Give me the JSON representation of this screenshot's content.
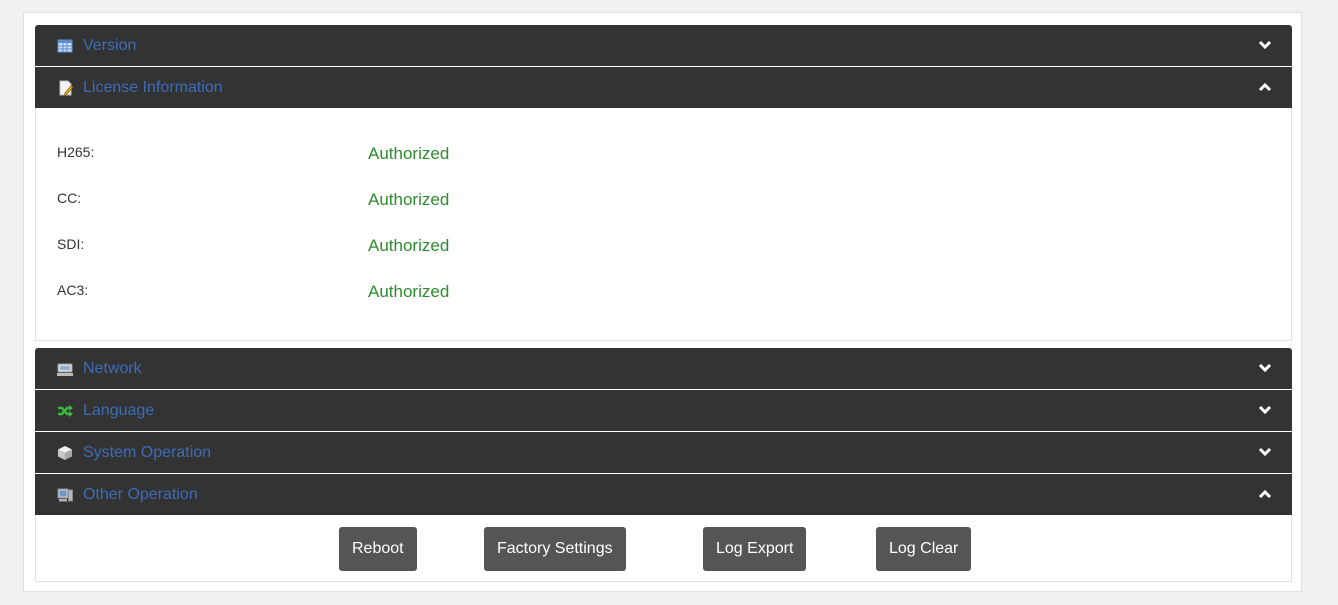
{
  "sections": {
    "version": {
      "title": "Version"
    },
    "license": {
      "title": "License Information"
    },
    "network": {
      "title": "Network"
    },
    "language": {
      "title": "Language"
    },
    "system": {
      "title": "System Operation"
    },
    "other": {
      "title": "Other Operation"
    }
  },
  "license_rows": [
    {
      "label": "H265:",
      "value": "Authorized"
    },
    {
      "label": "CC:",
      "value": "Authorized"
    },
    {
      "label": "SDI:",
      "value": "Authorized"
    },
    {
      "label": "AC3:",
      "value": "Authorized"
    }
  ],
  "buttons": {
    "reboot": "Reboot",
    "factory": "Factory Settings",
    "log_export": "Log Export",
    "log_clear": "Log Clear"
  },
  "colors": {
    "header_bg": "#333333",
    "title_blue": "#3c6cb8",
    "authorized_green": "#2e8b2e",
    "button_bg": "#555555"
  }
}
